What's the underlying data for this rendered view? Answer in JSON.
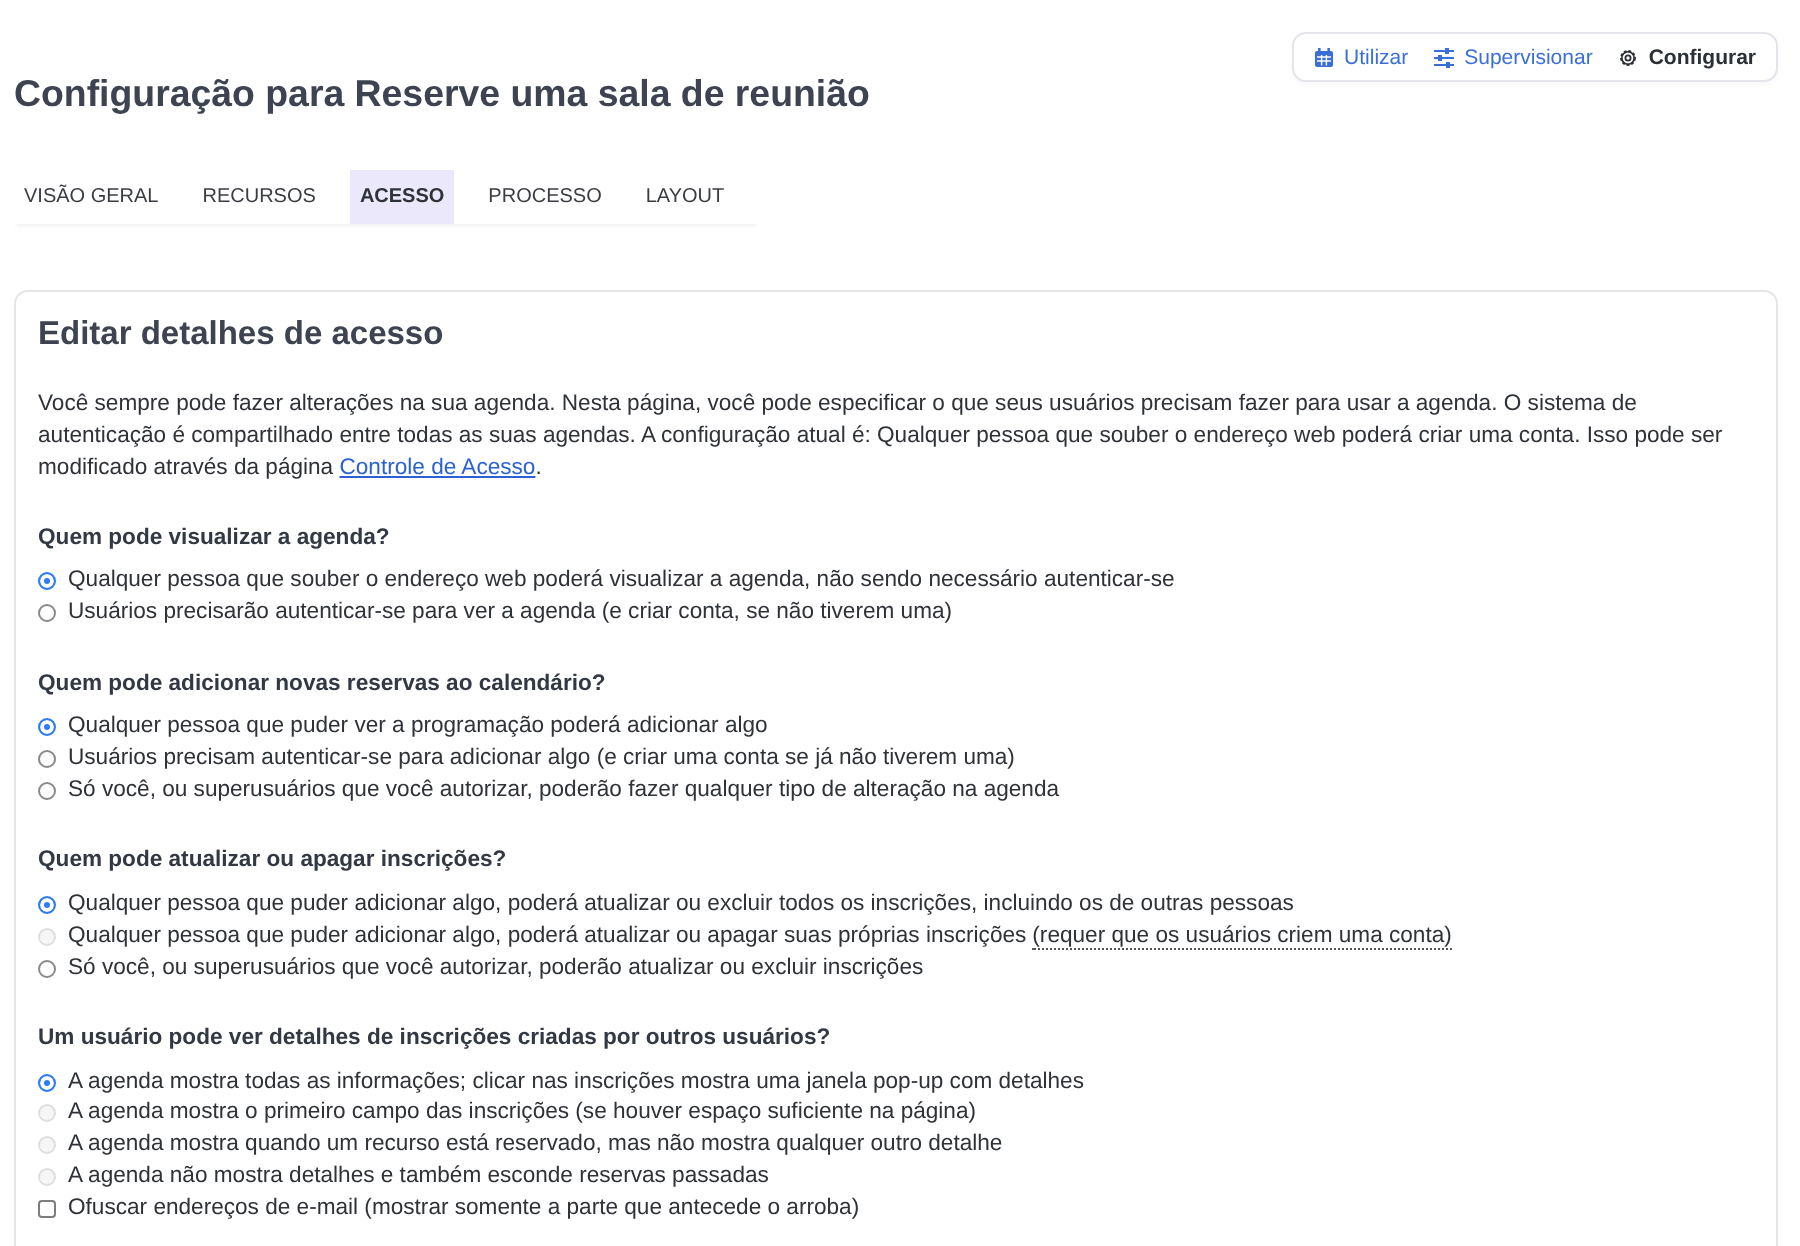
{
  "mode_switcher": [
    {
      "label": "Utilizar",
      "selected": false
    },
    {
      "label": "Supervisionar",
      "selected": false
    },
    {
      "label": "Configurar",
      "selected": true
    }
  ],
  "title": "Configuração para Reserve uma sala de reunião",
  "tabs": [
    {
      "label": "VISÃO GERAL",
      "selected": false
    },
    {
      "label": "RECURSOS",
      "selected": false
    },
    {
      "label": "ACESSO",
      "selected": true
    },
    {
      "label": "PROCESSO",
      "selected": false
    },
    {
      "label": "LAYOUT",
      "selected": false
    }
  ],
  "card": {
    "heading": "Editar detalhes de acesso",
    "intro": {
      "text": "Você sempre pode fazer alterações na sua agenda. Nesta página, você pode especificar o que seus usuários precisam fazer para usar a agenda. O sistema de autenticação é compartilhado entre todas as suas agendas. A configuração atual é: Qualquer pessoa que souber o endereço web poderá criar uma conta. Isso pode ser modificado através da página ",
      "link": "Controle de Acesso",
      "after": "."
    },
    "sections": [
      {
        "question": "Quem pode visualizar a agenda?",
        "options": [
          {
            "kind": "radio",
            "label": "Qualquer pessoa que souber o endereço web poderá visualizar a agenda, não sendo necessário autenticar-se",
            "selected": true,
            "disabled": false
          },
          {
            "kind": "radio",
            "label": "Usuários precisarão autenticar-se para ver a agenda (e criar conta, se não tiverem uma)",
            "selected": false,
            "disabled": false
          }
        ]
      },
      {
        "question": "Quem pode adicionar novas reservas ao calendário?",
        "options": [
          {
            "kind": "radio",
            "label": "Qualquer pessoa que puder ver a programação poderá adicionar algo",
            "selected": true,
            "disabled": false
          },
          {
            "kind": "radio",
            "label": "Usuários precisam autenticar-se para adicionar algo (e criar uma conta se já não tiverem uma)",
            "selected": false,
            "disabled": false
          },
          {
            "kind": "radio",
            "label": "Só você, ou superusuários que você autorizar, poderão fazer qualquer tipo de alteração na agenda",
            "selected": false,
            "disabled": false
          }
        ]
      },
      {
        "question": "Quem pode atualizar ou apagar inscrições?",
        "options": [
          {
            "kind": "radio",
            "label": "Qualquer pessoa que puder adicionar algo, poderá atualizar ou excluir todos os inscrições, incluindo os de outras pessoas",
            "selected": true,
            "disabled": false
          },
          {
            "kind": "radio",
            "label": "Qualquer pessoa que puder adicionar algo, poderá atualizar ou apagar suas próprias inscrições",
            "note": "(requer que os usuários criem uma conta)",
            "selected": false,
            "disabled": true
          },
          {
            "kind": "radio",
            "label": "Só você, ou superusuários que você autorizar, poderão atualizar ou excluir inscrições",
            "selected": false,
            "disabled": false
          }
        ]
      },
      {
        "question": "Um usuário pode ver detalhes de inscrições criadas por outros usuários?",
        "options": [
          {
            "kind": "radio",
            "label": "A agenda mostra todas as informações; clicar nas inscrições mostra uma janela pop-up com detalhes",
            "selected": true,
            "disabled": false
          },
          {
            "kind": "radio",
            "label": "A agenda mostra o primeiro campo das inscrições (se houver espaço suficiente na página)",
            "selected": false,
            "disabled": true
          },
          {
            "kind": "radio",
            "label": "A agenda mostra quando um recurso está reservado, mas não mostra qualquer outro detalhe",
            "selected": false,
            "disabled": true
          },
          {
            "kind": "radio",
            "label": "A agenda não mostra detalhes e também esconde reservas passadas",
            "selected": false,
            "disabled": true
          },
          {
            "kind": "checkbox",
            "label": "Ofuscar endereços de e-mail (mostrar somente a parte que antecede o arroba)",
            "checked": false,
            "disabled": false
          }
        ]
      }
    ]
  }
}
